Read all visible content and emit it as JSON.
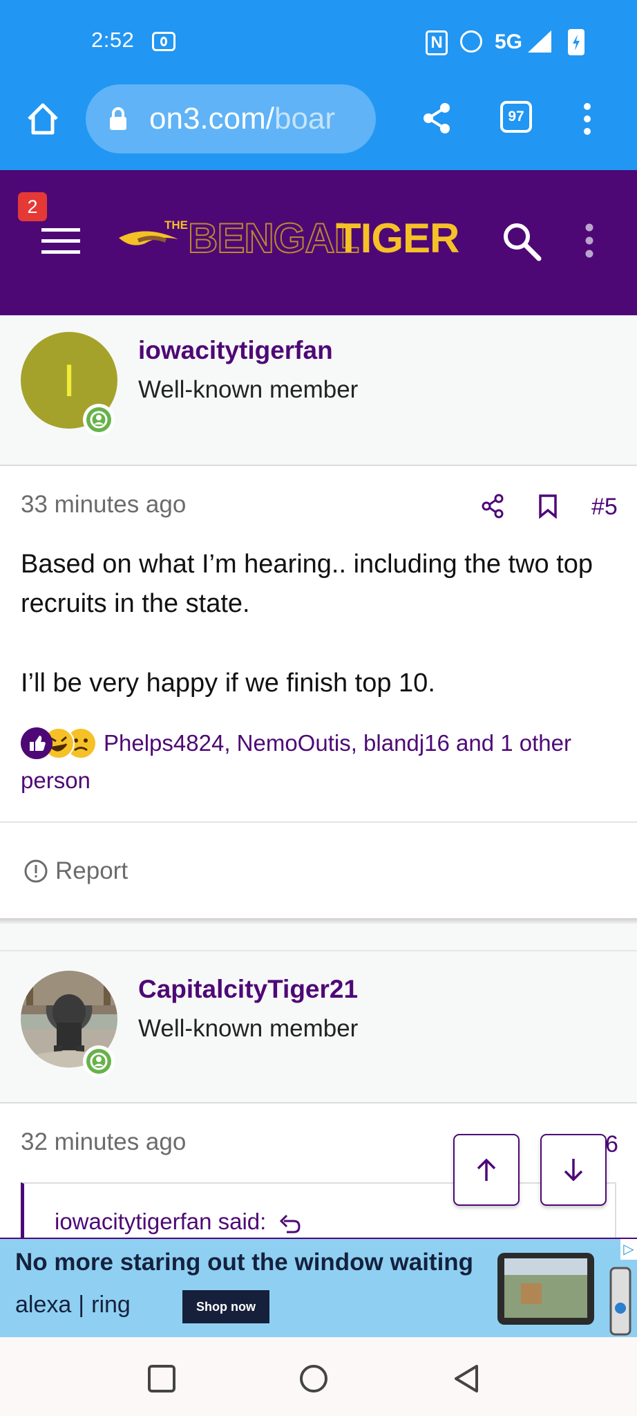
{
  "status_bar": {
    "time": "2:52",
    "network": "5G"
  },
  "browser": {
    "url_main": "on3.com/",
    "url_dim": "boar",
    "tab_count": "97"
  },
  "site": {
    "notification_count": "2",
    "logo_prefix": "THE",
    "logo_part1": "BENGAL",
    "logo_part2": "TIGER"
  },
  "posts": [
    {
      "avatar_letter": "I",
      "avatar_color": "#a5a22c",
      "username": "iowacitytigerfan",
      "role": "Well-known member",
      "time_ago": "33 minutes ago",
      "post_number": "#5",
      "paragraphs": [
        "Based on what I’m hearing.. including the two top recruits in the state.",
        "I’ll be very happy if we finish top 10."
      ],
      "reactions_text": "Phelps4824, NemoOutis, blandj16 and 1 other person",
      "report_label": "Report"
    },
    {
      "username": "CapitalcityTiger21",
      "role": "Well-known member",
      "time_ago": "32 minutes ago",
      "post_number_partial": "6",
      "quote_header": "iowacitytigerfan said:"
    }
  ],
  "ad": {
    "headline": "No more staring out the window waiting",
    "brand1": "alexa",
    "brand2": "ring",
    "cta": "Shop now"
  },
  "colors": {
    "brand_purple": "#4e0876",
    "brand_gold": "#f5c126",
    "status_blue": "#2196f3",
    "online_green": "#67b24a"
  }
}
